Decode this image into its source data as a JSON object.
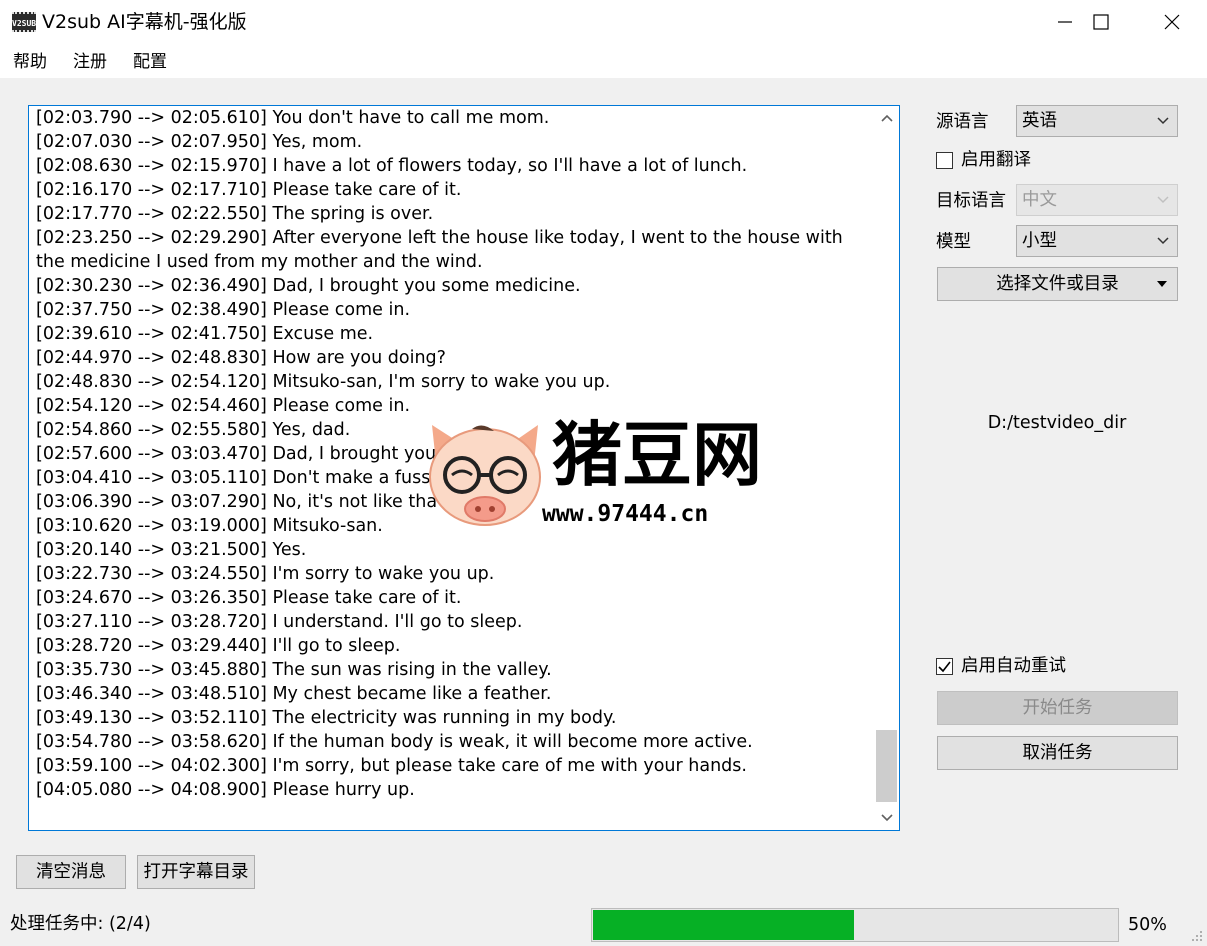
{
  "window": {
    "title": "V2sub AI字幕机-强化版",
    "icon_text": "V2SUB"
  },
  "menu": [
    "帮助",
    "注册",
    "配置"
  ],
  "log_lines": [
    {
      "ts": "[02:03.790 --> 02:05.610]",
      "text": "You don't have to call me mom."
    },
    {
      "ts": "[02:07.030 --> 02:07.950]",
      "text": "Yes, mom."
    },
    {
      "ts": "[02:08.630 --> 02:15.970]",
      "text": "I have a lot of flowers today, so I'll have a lot of lunch."
    },
    {
      "ts": "[02:16.170 --> 02:17.710]",
      "text": "Please take care of it."
    },
    {
      "ts": "[02:17.770 --> 02:22.550]",
      "text": "The spring is over."
    },
    {
      "ts": "[02:23.250 --> 02:29.290]",
      "text": "After everyone left the house like today, I went to the house with the medicine I used from my mother and the wind."
    },
    {
      "ts": "[02:30.230 --> 02:36.490]",
      "text": "Dad, I brought you some medicine."
    },
    {
      "ts": "[02:37.750 --> 02:38.490]",
      "text": "Please come in."
    },
    {
      "ts": "[02:39.610 --> 02:41.750]",
      "text": "Excuse me."
    },
    {
      "ts": "[02:44.970 --> 02:48.830]",
      "text": "How are you doing?"
    },
    {
      "ts": "[02:48.830 --> 02:54.120]",
      "text": "Mitsuko-san, I'm sorry to wake you up."
    },
    {
      "ts": "[02:54.120 --> 02:54.460]",
      "text": "Please come in."
    },
    {
      "ts": "[02:54.860 --> 02:55.580]",
      "text": "Yes, dad."
    },
    {
      "ts": "[02:57.600 --> 03:03.470]",
      "text": "Dad, I brought you"
    },
    {
      "ts": "[03:04.410 --> 03:05.110]",
      "text": "Don't make a fuss."
    },
    {
      "ts": "[03:06.390 --> 03:07.290]",
      "text": "No, it's not like tha"
    },
    {
      "ts": "[03:10.620 --> 03:19.000]",
      "text": "Mitsuko-san."
    },
    {
      "ts": "[03:20.140 --> 03:21.500]",
      "text": "Yes."
    },
    {
      "ts": "[03:22.730 --> 03:24.550]",
      "text": "I'm sorry to wake you up."
    },
    {
      "ts": "[03:24.670 --> 03:26.350]",
      "text": "Please take care of it."
    },
    {
      "ts": "[03:27.110 --> 03:28.720]",
      "text": "I understand. I'll go to sleep."
    },
    {
      "ts": "[03:28.720 --> 03:29.440]",
      "text": "I'll go to sleep."
    },
    {
      "ts": "[03:35.730 --> 03:45.880]",
      "text": "The sun was rising in the valley."
    },
    {
      "ts": "[03:46.340 --> 03:48.510]",
      "text": "My chest became like a feather."
    },
    {
      "ts": "[03:49.130 --> 03:52.110]",
      "text": "The electricity was running in my body."
    },
    {
      "ts": "[03:54.780 --> 03:58.620]",
      "text": "If the human body is weak, it will become more active."
    },
    {
      "ts": "[03:59.100 --> 04:02.300]",
      "text": "I'm sorry, but please take care of me with your hands."
    },
    {
      "ts": "[04:05.080 --> 04:08.900]",
      "text": "Please hurry up."
    }
  ],
  "side": {
    "source_lang_label": "源语言",
    "source_lang_value": "英语",
    "translate_label": "启用翻译",
    "translate_checked": false,
    "target_lang_label": "目标语言",
    "target_lang_value": "中文",
    "model_label": "模型",
    "model_value": "小型",
    "select_button": "选择文件或目录",
    "path": "D:/testvideo_dir",
    "auto_retry_label": "启用自动重试",
    "auto_retry_checked": true,
    "start_button": "开始任务",
    "cancel_button": "取消任务"
  },
  "bottom": {
    "clear_button": "清空消息",
    "open_button": "打开字幕目录",
    "status": "处理任务中: (2/4)",
    "progress": 0.5,
    "percent": "50%"
  },
  "watermark": {
    "title": "猪豆网",
    "url": "www.97444.cn"
  }
}
